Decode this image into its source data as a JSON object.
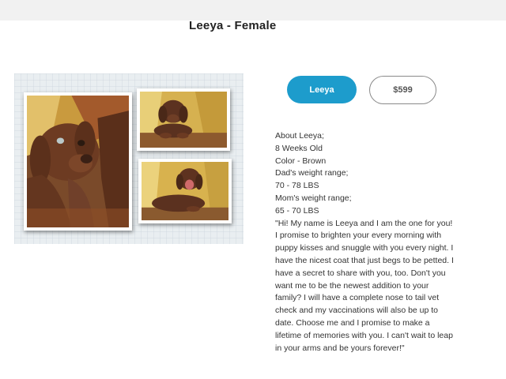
{
  "page": {
    "title": "Leeya - Female"
  },
  "collage": {
    "photos": [
      {
        "subject": "chocolate lab puppy close-up",
        "icon": "puppy-photo"
      },
      {
        "subject": "chocolate lab puppy lying on golden cloth",
        "icon": "puppy-photo"
      },
      {
        "subject": "chocolate lab puppy yawning",
        "icon": "puppy-photo"
      }
    ],
    "colors": {
      "fur": "#6b3a22",
      "backdrop": "#d9b34a",
      "frame": "#ffffff"
    }
  },
  "actions": {
    "name_button": "Leeya",
    "price_button": "$599",
    "accent": "#1d9ccc"
  },
  "details": {
    "about": "About Leeya;",
    "age": "8 Weeks Old",
    "color": "Color - Brown",
    "dad_label": "Dad's weight range;",
    "dad_range": "70 - 78 LBS",
    "mom_label": "Mom's weight range;",
    "mom_range": "65 - 70 LBS",
    "description": "\"Hi! My name is Leeya and I am the one for you! I promise to brighten your every morning with puppy kisses and snuggle with you every night. I have the nicest coat that just begs to be petted. I have a secret to share with you, too. Don't you want me to be the newest addition to your family? I will have a complete nose to tail vet check and my vaccinations will also be up to date. Choose me and I promise to make a lifetime of memories with you. I can't wait to leap in your arms and be yours forever!\""
  }
}
